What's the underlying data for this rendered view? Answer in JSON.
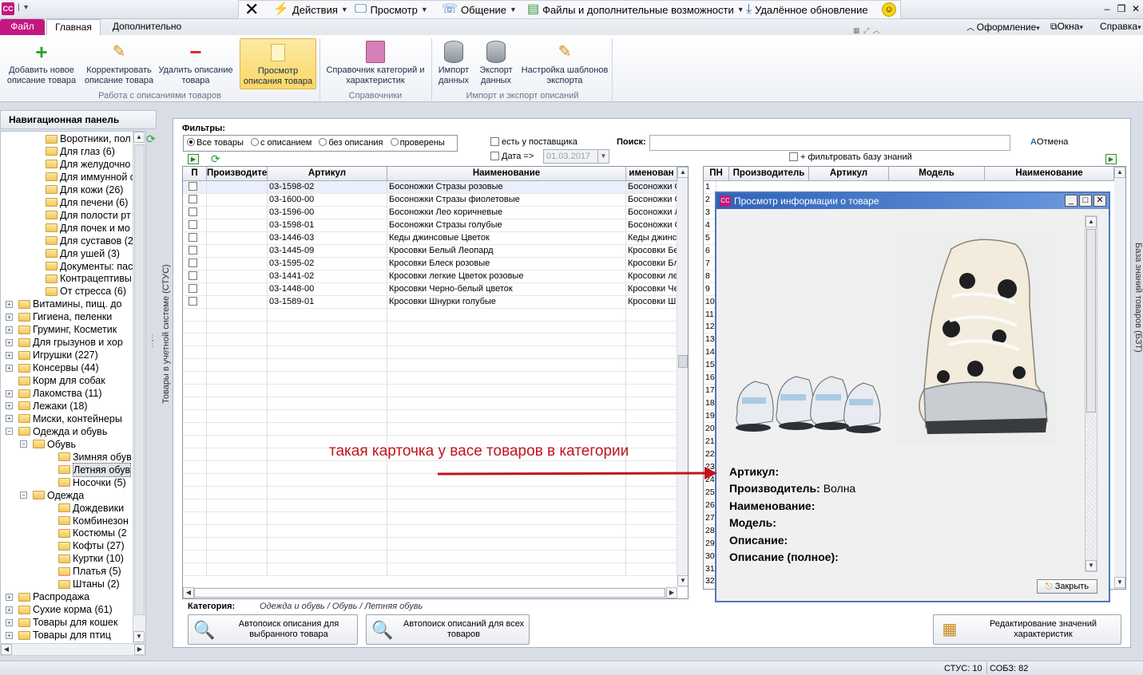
{
  "titlebar": {
    "app_icon": "CC",
    "actions_label": "Действия",
    "view_label": "Просмотр",
    "communication_label": "Общение",
    "files_label": "Файлы и дополнительные возможности",
    "remote_update_label": "Удалённое обновление"
  },
  "tabs": {
    "file": "Файл",
    "main": "Главная",
    "extra": "Дополнительно",
    "design": "Оформление",
    "windows": "Окна",
    "help": "Справка"
  },
  "ribbon": {
    "add": "Добавить новое описание товара",
    "edit": "Корректировать описание товара",
    "delete": "Удалить описание товара",
    "view": "Просмотр описания товара",
    "categories": "Справочник категорий и характеристик",
    "import": "Импорт данных",
    "export": "Экспорт данных",
    "templates": "Настройка шаблонов экспорта",
    "group1": "Работа с описаниями товаров",
    "group2": "Справочники",
    "group3": "Импорт и экспорт описаний"
  },
  "nav": {
    "title": "Навигационная панель",
    "items": [
      {
        "label": "Воротники, пол",
        "level": 3,
        "expander": ""
      },
      {
        "label": "Для глаз (6)",
        "level": 3,
        "expander": ""
      },
      {
        "label": "Для желудочно",
        "level": 3,
        "expander": ""
      },
      {
        "label": "Для иммунной с",
        "level": 3,
        "expander": ""
      },
      {
        "label": "Для кожи (26)",
        "level": 3,
        "expander": ""
      },
      {
        "label": "Для печени (6)",
        "level": 3,
        "expander": ""
      },
      {
        "label": "Для полости рт",
        "level": 3,
        "expander": ""
      },
      {
        "label": "Для почек и мо",
        "level": 3,
        "expander": ""
      },
      {
        "label": "Для суставов (2",
        "level": 3,
        "expander": ""
      },
      {
        "label": "Для ушей (3)",
        "level": 3,
        "expander": ""
      },
      {
        "label": "Документы: пас",
        "level": 3,
        "expander": ""
      },
      {
        "label": "Контрацептивы",
        "level": 3,
        "expander": ""
      },
      {
        "label": "От стресса (6)",
        "level": 3,
        "expander": ""
      },
      {
        "label": "Витамины, пищ. до",
        "level": 1,
        "expander": "+"
      },
      {
        "label": "Гигиена, пеленки",
        "level": 1,
        "expander": "+"
      },
      {
        "label": "Груминг, Косметик",
        "level": 1,
        "expander": "+"
      },
      {
        "label": "Для грызунов и хор",
        "level": 1,
        "expander": "+"
      },
      {
        "label": "Игрушки (227)",
        "level": 1,
        "expander": "+"
      },
      {
        "label": "Консервы (44)",
        "level": 1,
        "expander": "+"
      },
      {
        "label": "Корм для собак",
        "level": 1,
        "expander": ""
      },
      {
        "label": "Лакомства (11)",
        "level": 1,
        "expander": "+"
      },
      {
        "label": "Лежаки (18)",
        "level": 1,
        "expander": "+"
      },
      {
        "label": "Миски, контейнеры",
        "level": 1,
        "expander": "+"
      },
      {
        "label": "Одежда и обувь",
        "level": 1,
        "expander": "−"
      },
      {
        "label": "Обувь",
        "level": 2,
        "expander": "−"
      },
      {
        "label": "Зимняя обув",
        "level": 4,
        "expander": ""
      },
      {
        "label": "Летняя обув",
        "level": 4,
        "expander": "",
        "selected": true
      },
      {
        "label": "Носочки (5)",
        "level": 4,
        "expander": ""
      },
      {
        "label": "Одежда",
        "level": 2,
        "expander": "−"
      },
      {
        "label": "Дождевики",
        "level": 4,
        "expander": ""
      },
      {
        "label": "Комбинезон",
        "level": 4,
        "expander": ""
      },
      {
        "label": "Костюмы (2",
        "level": 4,
        "expander": ""
      },
      {
        "label": "Кофты (27)",
        "level": 4,
        "expander": ""
      },
      {
        "label": "Куртки (10)",
        "level": 4,
        "expander": ""
      },
      {
        "label": "Платья (5)",
        "level": 4,
        "expander": ""
      },
      {
        "label": "Штаны (2)",
        "level": 4,
        "expander": ""
      },
      {
        "label": "Распродажа",
        "level": 1,
        "expander": "+"
      },
      {
        "label": "Сухие корма (61)",
        "level": 1,
        "expander": "+"
      },
      {
        "label": "Товары для кошек",
        "level": 1,
        "expander": "+"
      },
      {
        "label": "Товары для птиц",
        "level": 1,
        "expander": "+"
      }
    ]
  },
  "side": {
    "left_vertical": "Товары в учетной системе (СТУС)",
    "right_vertical": "База знаний товаров (БЗТ)"
  },
  "filters": {
    "title": "Фильтры:",
    "all": "Все товары",
    "with_desc": "с описанием",
    "without_desc": "без описания",
    "checked": "проверены",
    "supplier": "есть у поставщика",
    "date_label": "Дата =>",
    "date_value": "01.03.2017",
    "search_label": "Поиск:",
    "search_value": "",
    "cancel": "Отмена",
    "filter_kb": "+ фильтровать базу знаний"
  },
  "left_grid": {
    "headers": [
      "П",
      "Производите",
      "Артикул",
      "Наименование",
      "именован"
    ],
    "rows": [
      {
        "art": "03-1598-02",
        "name": "Босоножки Стразы розовые",
        "name2": "Босоножки С"
      },
      {
        "art": "03-1600-00",
        "name": "Босоножки Стразы фиолетовые",
        "name2": "Босоножки С"
      },
      {
        "art": "03-1596-00",
        "name": "Босоножки Лео коричневые",
        "name2": "Босоножки Л"
      },
      {
        "art": "03-1598-01",
        "name": "Босоножки Стразы голубые",
        "name2": "Босоножки С"
      },
      {
        "art": "03-1446-03",
        "name": "Кеды джинсовые Цветок",
        "name2": "Кеды джинс"
      },
      {
        "art": "03-1445-09",
        "name": "Кросовки Белый Леопард",
        "name2": "Кросовки Бе"
      },
      {
        "art": "03-1595-02",
        "name": "Кросовки Блеск розовые",
        "name2": "Кросовки Бл"
      },
      {
        "art": "03-1441-02",
        "name": "Кросовки легкие Цветок розовые",
        "name2": "Кросовки ле"
      },
      {
        "art": "03-1448-00",
        "name": "Кросовки Черно-белый цветок",
        "name2": "Кросовки Че"
      },
      {
        "art": "03-1589-01",
        "name": "Кросовки Шнурки голубые",
        "name2": "Кросовки Ш"
      }
    ]
  },
  "right_grid": {
    "headers": [
      "ПН",
      "Производитель",
      "Артикул",
      "Модель",
      "Наименование"
    ],
    "row_numbers": [
      "1",
      "2",
      "3",
      "4",
      "5",
      "6",
      "7",
      "8",
      "9",
      "10",
      "11",
      "12",
      "13",
      "14",
      "15",
      "16",
      "17",
      "18",
      "19",
      "20",
      "21",
      "22",
      "23",
      "24",
      "25",
      "26",
      "27",
      "28",
      "29",
      "30",
      "31",
      "32"
    ]
  },
  "category": {
    "label": "Категория:",
    "value": "Одежда и обувь / Обувь / Летняя обувь"
  },
  "buttons": {
    "autosearch_one": "Автопоиск описания для выбранного товара",
    "autosearch_all": "Автопоиск описаний для всех товаров",
    "edit_values": "Редактирование значений характеристик"
  },
  "popup": {
    "title": "Просмотр информации о товаре",
    "article_label": "Артикул:",
    "article_value": "",
    "maker_label": "Производитель:",
    "maker_value": "Волна",
    "name_label": "Наименование:",
    "model_label": "Модель:",
    "desc_label": "Описание:",
    "desc_full_label": "Описание (полное):",
    "close": "Закрыть"
  },
  "annotation": "такая карточка у васе товаров в категории",
  "annotation_color": "#c0141b",
  "status": {
    "stus": "СТУС: 10",
    "sobz": "СОБЗ: 82"
  }
}
